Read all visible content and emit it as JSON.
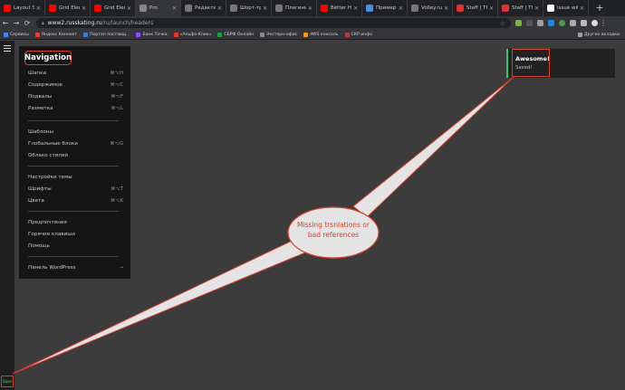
{
  "browser": {
    "tabs": [
      {
        "title": "Layout Si",
        "color": "#ff0000"
      },
      {
        "title": "Grid Elem",
        "color": "#ff0000"
      },
      {
        "title": "Grid Elem",
        "color": "#ff0000"
      },
      {
        "title": "Pro",
        "color": "#888888",
        "active": true
      },
      {
        "title": "Редактир",
        "color": "#777777"
      },
      {
        "title": "Шорт-тр",
        "color": "#777777"
      },
      {
        "title": "Плагины",
        "color": "#777777"
      },
      {
        "title": "Better He",
        "color": "#ff0000"
      },
      {
        "title": "Пример",
        "color": "#4a90e2"
      },
      {
        "title": "Volley.ru",
        "color": "#777777"
      },
      {
        "title": "Staff | Th",
        "color": "#e03030"
      },
      {
        "title": "Staff | Th",
        "color": "#e03030"
      },
      {
        "title": "Issue wit",
        "color": "#ffffff"
      }
    ],
    "new_tab": "+",
    "url_host": "www2.russkating.ru",
    "url_path": "/ru/launch/headers",
    "bookmarks": [
      {
        "label": "Сервисы",
        "color": "#4285f4"
      },
      {
        "label": "Яндекс Коннект",
        "color": "#ff3333"
      },
      {
        "label": "Портал поставщ...",
        "color": "#3a7bd5"
      },
      {
        "label": "Банк Точка",
        "color": "#8a4fff"
      },
      {
        "label": "«Альфа-Клик»",
        "color": "#ef3124"
      },
      {
        "label": "СБРФ Онлайн",
        "color": "#21a038"
      },
      {
        "label": "Экстерн-офис",
        "color": "#888888"
      },
      {
        "label": "AWS консоль",
        "color": "#ff9900"
      },
      {
        "label": "СКР инфо",
        "color": "#cc3333"
      }
    ],
    "other_bookmarks": "Другие вкладки"
  },
  "nav": {
    "title": "Navigation",
    "groups": [
      [
        {
          "label": "Шапки",
          "shortcut": "⌘⌥H"
        },
        {
          "label": "Содержимое",
          "shortcut": "⌘⌥C"
        },
        {
          "label": "Подвалы",
          "shortcut": "⌘⌥F"
        },
        {
          "label": "Разметка",
          "shortcut": "⌘⌥L"
        }
      ],
      [
        {
          "label": "Шаблоны",
          "shortcut": ""
        },
        {
          "label": "Глобальные блоки",
          "shortcut": "⌘⌥G"
        },
        {
          "label": "Облако стилей",
          "shortcut": ""
        }
      ],
      [
        {
          "label": "Настройки темы",
          "shortcut": ""
        },
        {
          "label": "Шрифты",
          "shortcut": "⌘⌥T"
        },
        {
          "label": "Цвета",
          "shortcut": "⌘⌥K"
        }
      ],
      [
        {
          "label": "Предпочтения",
          "shortcut": ""
        },
        {
          "label": "Горячие клавиши",
          "shortcut": ""
        },
        {
          "label": "Помощь",
          "shortcut": ""
        }
      ],
      [
        {
          "label": "Панель WordPress",
          "shortcut": "→"
        }
      ]
    ]
  },
  "toast": {
    "title": "Awesome!",
    "message": "Saved!"
  },
  "save_button": "Save",
  "annotation": {
    "line1": "Missing trsnlations or",
    "line2": "bad references"
  },
  "colors": {
    "accent_red": "#d7402b",
    "success_green": "#36c96b"
  }
}
